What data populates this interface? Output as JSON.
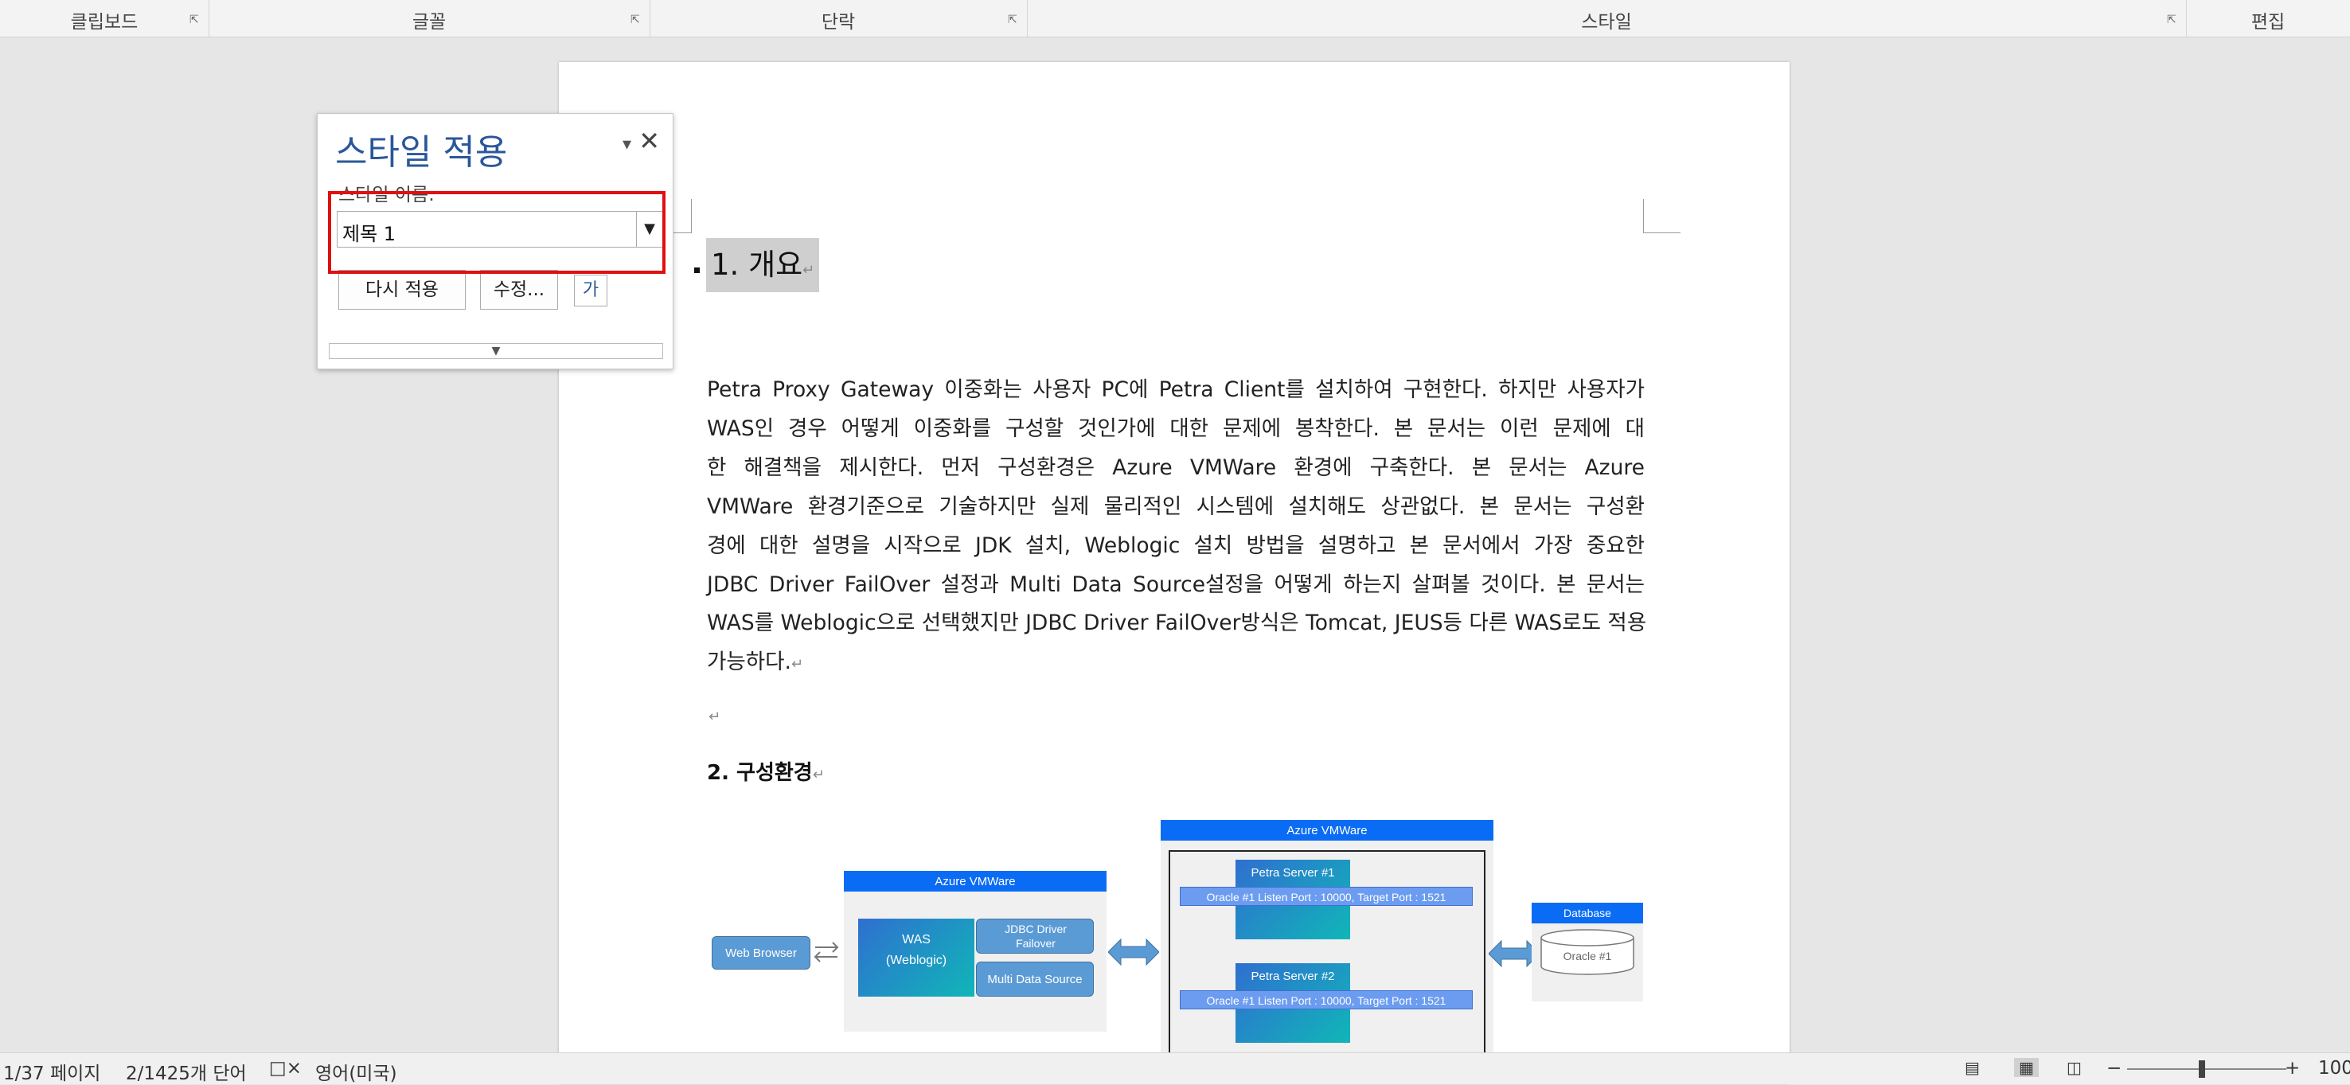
{
  "ribbon": {
    "groups": [
      "클립보드",
      "글꼴",
      "단락",
      "스타일",
      "편집"
    ]
  },
  "document": {
    "heading1": "1. 개요",
    "body_lines": [
      "Petra Proxy Gateway 이중화는 사용자 PC에 Petra Client를 설치하여 구현한다. 하지만 사용자가",
      "WAS인 경우 어떻게 이중화를 구성할 것인가에 대한 문제에 봉착한다. 본 문서는 이런 문제에 대",
      "한 해결책을 제시한다. 먼저 구성환경은 Azure VMWare 환경에 구축한다. 본 문서는 Azure",
      "VMWare 환경기준으로 기술하지만 실제 물리적인 시스템에 설치해도 상관없다. 본 문서는 구성환",
      "경에 대한 설명을 시작으로 JDK 설치, Weblogic 설치 방법을 설명하고 본 문서에서 가장 중요한",
      "JDBC Driver FailOver 설정과 Multi Data Source설정을 어떻게 하는지 살펴볼 것이다. 본 문서는",
      "WAS를 Weblogic으로 선택했지만 JDBC Driver FailOver방식은 Tomcat, JEUS등 다른 WAS로도 적용",
      "가능하다."
    ],
    "heading2": "2. 구성환경",
    "paragraph_mark": "↵"
  },
  "diagram": {
    "web_browser": "Web Browser",
    "was_header": "Azure VMWare",
    "was_title": "WAS",
    "was_sub": "(Weblogic)",
    "jdbc_failover": "JDBC Driver Failover",
    "multi_ds": "Multi Data Source",
    "petra_header": "Azure VMWare",
    "petra1": "Petra Server #1",
    "petra2": "Petra Server #2",
    "port_info": "Oracle #1 Listen Port : 10000, Target Port : 1521",
    "db_header": "Database",
    "db_name": "Oracle #1"
  },
  "dialog": {
    "title": "스타일 적용",
    "label": "스타일 이름:",
    "value": "제목 1",
    "reapply": "다시 적용",
    "modify": "수정...",
    "icon_glyph": "가"
  },
  "status": {
    "page": "1/37 페이지",
    "words": "2/1425개 단어",
    "language": "영어(미국)",
    "zoom": "100"
  },
  "colors": {
    "dialog_title": "#2b579a",
    "highlight": "#e01010",
    "diagram_header": "#0a6cf5"
  }
}
